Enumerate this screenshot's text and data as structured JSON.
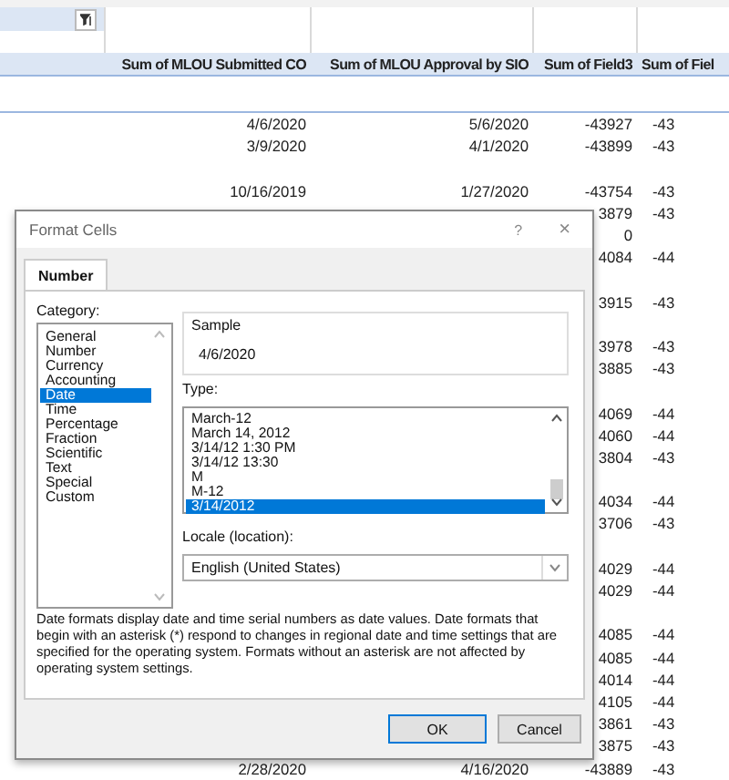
{
  "sheet": {
    "columns": [
      "Sum of MLOU Submitted CO",
      "Sum of MLOU Approval by SIO",
      "Sum of Field3",
      "Sum of Fiel"
    ],
    "rows": [
      {
        "column_b": "4/6/2020",
        "column_c": "5/6/2020",
        "column_d": "-43927",
        "column_e": "-43"
      },
      {
        "column_b": "3/9/2020",
        "column_c": "4/1/2020",
        "column_d": "-43899",
        "column_e": "-43"
      },
      {},
      {
        "column_b": "10/16/2019",
        "column_c": "1/27/2020",
        "column_d": "-43754",
        "column_e": "-43"
      },
      {
        "column_d": "3879",
        "column_e": "-43"
      },
      {
        "column_d": "0"
      },
      {
        "column_d": "4084",
        "column_e": "-44"
      },
      {},
      {
        "column_d": "3915",
        "column_e": "-43"
      },
      {},
      {
        "column_d": "3978",
        "column_e": "-43"
      },
      {
        "column_d": "3885",
        "column_e": "-43"
      },
      {},
      {
        "column_d": "4069",
        "column_e": "-44"
      },
      {
        "column_d": "4060",
        "column_e": "-44"
      },
      {
        "column_d": "3804",
        "column_e": "-43"
      },
      {},
      {
        "column_d": "4034",
        "column_e": "-44"
      },
      {
        "column_d": "3706",
        "column_e": "-43"
      },
      {},
      {
        "column_d": "4029",
        "column_e": "-44"
      },
      {
        "column_d": "4029",
        "column_e": "-44"
      },
      {},
      {
        "column_d": "4085",
        "column_e": "-44"
      },
      {
        "column_d": "4085",
        "column_e": "-44"
      },
      {
        "column_d": "4014",
        "column_e": "-44"
      },
      {
        "column_d": "4105",
        "column_e": "-44"
      },
      {
        "column_d": "3861",
        "column_e": "-43"
      },
      {
        "column_d": "3875",
        "column_e": "-43"
      },
      {
        "column_b": "2/28/2020",
        "column_c": "4/16/2020",
        "column_d": "-43889",
        "column_e": "-43"
      }
    ]
  },
  "dialog": {
    "title": "Format Cells",
    "help": "?",
    "close": "×",
    "tabs": [
      {
        "label": "Number",
        "selected": true
      }
    ],
    "category": {
      "label": "Category:",
      "items": [
        {
          "label": "General",
          "selected": false
        },
        {
          "label": "Number",
          "selected": false
        },
        {
          "label": "Currency",
          "selected": false
        },
        {
          "label": "Accounting",
          "selected": false
        },
        {
          "label": "Date",
          "selected": true
        },
        {
          "label": "Time",
          "selected": false
        },
        {
          "label": "Percentage",
          "selected": false
        },
        {
          "label": "Fraction",
          "selected": false
        },
        {
          "label": "Scientific",
          "selected": false
        },
        {
          "label": "Text",
          "selected": false
        },
        {
          "label": "Special",
          "selected": false
        },
        {
          "label": "Custom",
          "selected": false
        }
      ]
    },
    "sample": {
      "label": "Sample",
      "value": "4/6/2020"
    },
    "type": {
      "label": "Type:",
      "items": [
        {
          "label": "March-12",
          "selected": false
        },
        {
          "label": "March 14, 2012",
          "selected": false
        },
        {
          "label": "3/14/12 1:30 PM",
          "selected": false
        },
        {
          "label": "3/14/12 13:30",
          "selected": false
        },
        {
          "label": "M",
          "selected": false
        },
        {
          "label": "M-12",
          "selected": false
        },
        {
          "label": "3/14/2012",
          "selected": true
        }
      ]
    },
    "locale": {
      "label": "Locale (location):",
      "value": "English (United States)"
    },
    "description": "Date formats display date and time serial numbers as date values.  Date formats that begin with an asterisk (*) respond to changes in regional date and time settings that are specified for the operating system. Formats without an asterisk are not affected by operating system settings.",
    "buttons": [
      {
        "label": "OK",
        "default": true
      },
      {
        "label": "Cancel",
        "default": false
      }
    ]
  }
}
